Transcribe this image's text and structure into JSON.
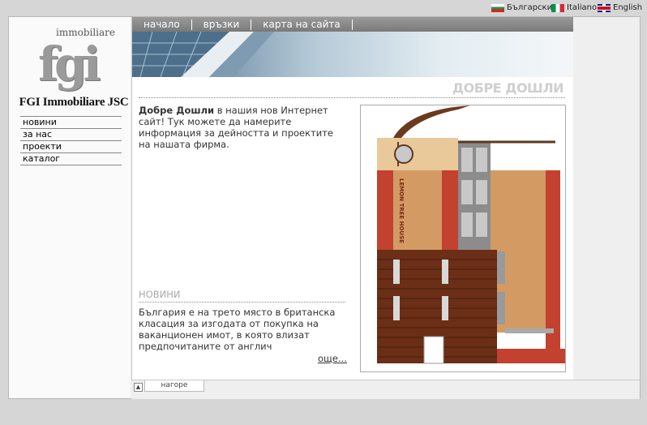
{
  "languages": [
    {
      "label": "Български",
      "flag": "bulgaria-flag-icon"
    },
    {
      "label": "Italiano",
      "flag": "italy-flag-icon"
    },
    {
      "label": "English",
      "flag": "uk-flag-icon"
    }
  ],
  "logo": {
    "word": "immobiliare",
    "letters": "fgi"
  },
  "company": "FGI Immobiliare JSC",
  "side_nav": [
    "новини",
    "за нас",
    "проекти",
    "каталог"
  ],
  "top_nav": [
    "начало",
    "връзки",
    "карта на сайта"
  ],
  "welcome": {
    "heading": "ДОБРЕ ДОШЛИ",
    "intro_bold": "Добре Дошли",
    "intro_rest": " в нашия нов Интернет сайт!  Тук можете да намерите информация за дейността и проектите на нашата фирма."
  },
  "news": {
    "heading": "НОВИНИ",
    "text": "България е на трето място в британска класация за изгодата от покупка на ваканционен имот, в която влизат предпочитаните от англич",
    "more": "още..."
  },
  "building": {
    "sign": "LEMON TREE HOUSE"
  },
  "footer": {
    "up_label": "нагоре"
  }
}
